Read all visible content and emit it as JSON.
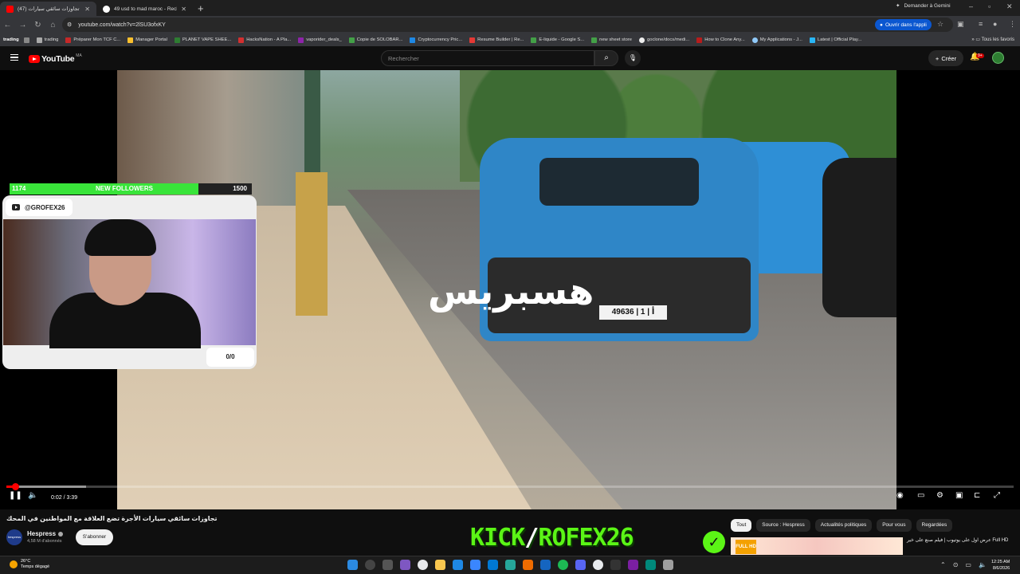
{
  "browser": {
    "tabs": [
      {
        "title": "تجاوزات سائقي سيارات (47) ◀",
        "active": true
      },
      {
        "title": "49 usd to mad maroc - Recherc",
        "active": false
      }
    ],
    "gemini_label": "Demander à Gemini",
    "url": "youtube.com/watch?v=2lSU3ofxKY",
    "open_app_label": "Ouvrir dans l'appli",
    "bookmarks": [
      "trading",
      "trading",
      "Préparer Mon TCF C...",
      "Manager Portal",
      "PLANET VAPE SHEE...",
      "HacksNation - A Pla...",
      "vaporider_deals_",
      "Copie de SOLOBAR...",
      "Cryptocurrency Pric...",
      "Resume Builder | Re...",
      "E-liquide - Google S...",
      "new sheet store",
      "goclone/docs/medi...",
      "How to Clone Any...",
      "My Applications - J...",
      "Latest | Official Play..."
    ],
    "all_bookmarks_label": "Tous les favoris"
  },
  "youtube": {
    "logo_text": "YouTube",
    "country_code": "MA",
    "search_placeholder": "Rechercher",
    "create_label": "Créer",
    "notification_count": "9+"
  },
  "player": {
    "time_display": "0:02 / 3:39",
    "progress_fraction": 0.009,
    "watermark_text": "هسبريس",
    "plate_text": "49636 | أ | 1"
  },
  "overlay": {
    "followers_current": "1174",
    "followers_label": "NEW FOLLOWERS",
    "followers_goal": "1500",
    "followers_fraction": 0.78,
    "handle": "@GROFEX26",
    "counter": "0/0",
    "kick_green": "KICK",
    "kick_slash": "/",
    "kick_name": "ROFEX26"
  },
  "video": {
    "title": "تجاوزات سائقي سيارات الأجرة تضع العلاقة مع المواطنين في المحك",
    "channel_avatar_text": "hespress",
    "channel_name": "Hespress",
    "subscribers": "4,58 M d'abonnés",
    "subscribe_label": "S'abonner"
  },
  "suggestions": {
    "chips": [
      "Tout",
      "Source : Hespress",
      "Actualités politiques",
      "Pour vous",
      "Regardées"
    ],
    "thumb_badge": "FULL HD",
    "title": "عرض اول على يوتيوب | فيلم صنع على خير Full HD"
  },
  "taskbar": {
    "temperature": "26°C",
    "weather_label": "Temps dégagé",
    "time": "12:25 AM",
    "date": "8/6/2026"
  },
  "colors": {
    "youtube_red": "#ff0000",
    "kick_green": "#5bf516",
    "followers_green": "#39e43a",
    "taxi_blue": "#2f86c7"
  }
}
